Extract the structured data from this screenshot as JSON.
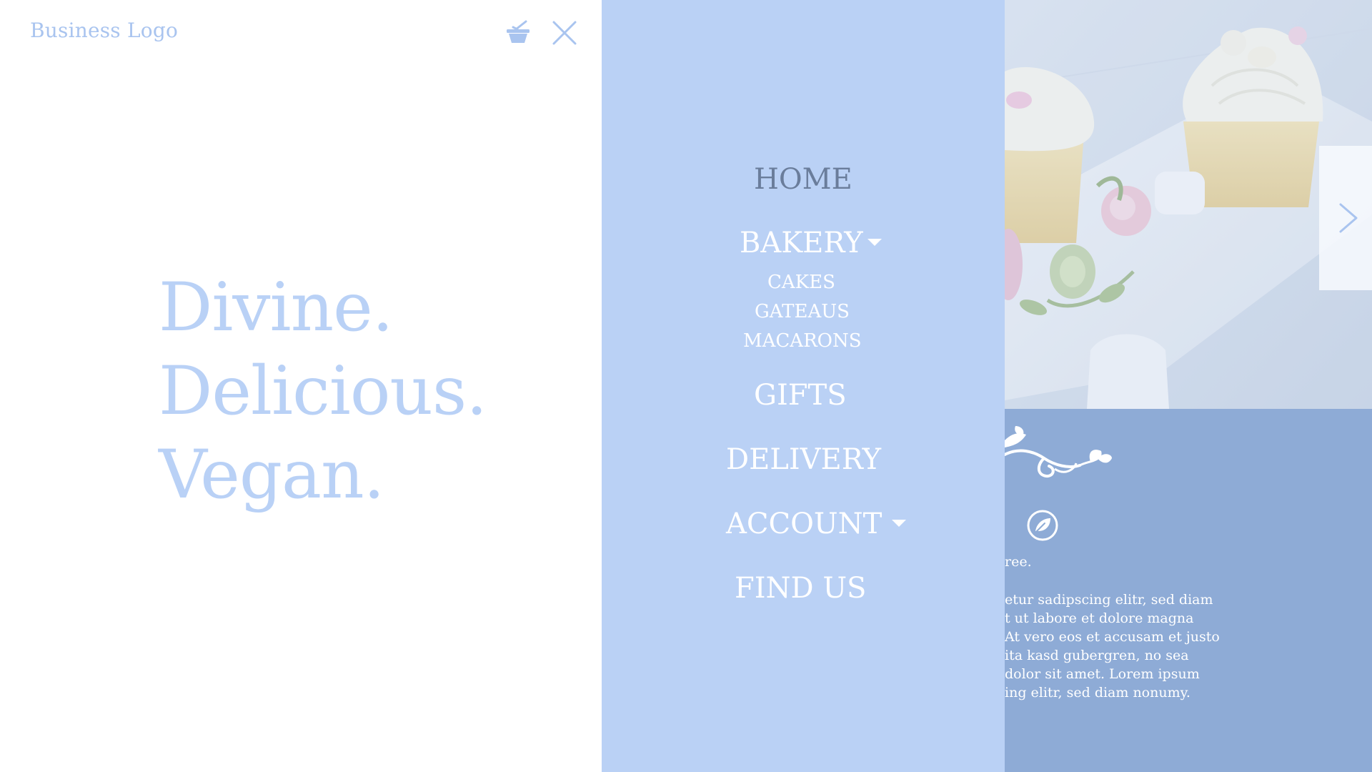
{
  "header": {
    "logo_text": "Business Logo",
    "basket_icon": "shopping-basket-icon",
    "close_icon": "close-icon"
  },
  "tagline": {
    "line1": "Divine.",
    "line2": "Delicious.",
    "line3": "Vegan."
  },
  "menu": {
    "home": "HOME",
    "bakery": "BAKERY",
    "bakery_sub": [
      "CAKES",
      "GATEAUS",
      "MACARONS"
    ],
    "gifts": "GIFTS",
    "delivery": "DELIVERY",
    "account": "ACCOUNT",
    "find_us": "FIND US",
    "dropdown_icon": "caret-down-icon"
  },
  "content": {
    "short_text": "ree.",
    "body_lines": [
      "etur sadipscing elitr, sed diam",
      "t ut labore et dolore magna",
      "At vero eos et accusam et justo",
      "ita kasd gubergren, no sea",
      "dolor sit amet. Lorem ipsum",
      "ing elitr, sed diam nonumy."
    ],
    "slider_icon": "chevron-right-icon",
    "leaf_icon": "leaf-icon",
    "flourish_icon": "floral-flourish-icon"
  },
  "colors": {
    "menu_bg": "#bad1f5",
    "right_bg": "#8eabd6",
    "logo": "#a9c4ef",
    "tagline": "#b9d1f6",
    "home_text": "#6a7d9b"
  }
}
